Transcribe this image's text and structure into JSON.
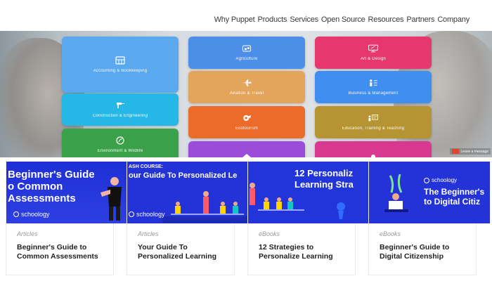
{
  "nav": {
    "items": [
      "Why Puppet",
      "Products",
      "Services",
      "Open Source",
      "Resources",
      "Partners",
      "Company"
    ]
  },
  "tiles": [
    {
      "label": "Accounting & Bookkeeping",
      "icon": "calculator-icon"
    },
    {
      "label": "Construction & Engineering",
      "icon": "drill-icon"
    },
    {
      "label": "Environment & Wildlife",
      "icon": "leaf-icon"
    },
    {
      "label": "Agriculture",
      "icon": "tractor-icon"
    },
    {
      "label": "Aviation & Travel",
      "icon": "airplane-icon"
    },
    {
      "label": "Ecotourism",
      "icon": "globe-icon"
    },
    {
      "label": "Art & Design",
      "icon": "monitor-icon"
    },
    {
      "label": "Business & Management",
      "icon": "people-icon"
    },
    {
      "label": "Education, Training & Teaching",
      "icon": "board-icon"
    }
  ],
  "chat": {
    "label": "Leave a message"
  },
  "cards": [
    {
      "type": "Articles",
      "title": "Beginner's Guide to Common Assessments",
      "thumb_lines": [
        "Beginner's Guide",
        "o Common",
        "Assessments"
      ],
      "brand": "schoology"
    },
    {
      "type": "Articles",
      "title": "Your Guide To Personalized Learning",
      "thumb_kicker": "ASH COURSE:",
      "thumb_lines": [
        "our Guide To Personalized Le"
      ],
      "brand": "schoology"
    },
    {
      "type": "eBooks",
      "title": "12 Strategies to Personalize Learning",
      "thumb_lines": [
        "12 Personaliz",
        "Learning Stra"
      ]
    },
    {
      "type": "eBooks",
      "title": "Beginner's Guide to Digital Citizenship",
      "brand": "schoology",
      "thumb_lines": [
        "The Beginner's",
        "to Digital Citiz"
      ]
    }
  ]
}
